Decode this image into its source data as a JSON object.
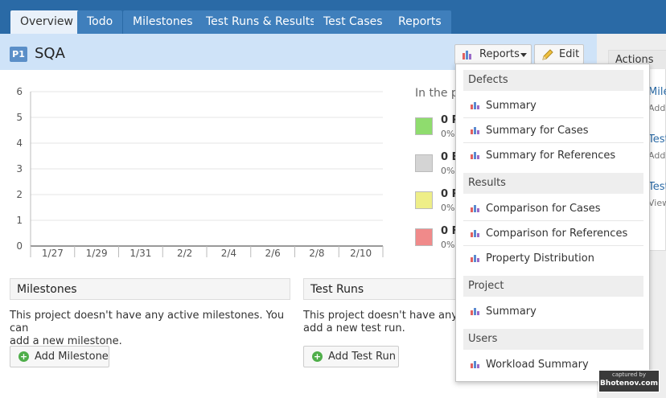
{
  "nav": {
    "tabs": [
      {
        "label": "Overview"
      },
      {
        "label": "Todo"
      },
      {
        "label": "Milestones"
      },
      {
        "label": "Test Runs & Results"
      },
      {
        "label": "Test Cases"
      },
      {
        "label": "Reports"
      }
    ],
    "active_tab": "Overview"
  },
  "project": {
    "badge": "P1",
    "title": "SQA"
  },
  "header_buttons": {
    "reports_label": "Reports",
    "edit_label": "Edit"
  },
  "sidebar": {
    "actions_label": "Actions",
    "links": [
      {
        "label": "Mile",
        "sub": "Add"
      },
      {
        "label": "Test",
        "sub": "Add"
      },
      {
        "label": "Test",
        "sub": "View"
      }
    ]
  },
  "chart_data": {
    "type": "line",
    "categories": [
      "1/27",
      "1/29",
      "1/31",
      "2/2",
      "2/4",
      "2/6",
      "2/8",
      "2/10"
    ],
    "series": [],
    "ylim": [
      0,
      6
    ],
    "yticks": [
      0,
      1,
      2,
      3,
      4,
      5,
      6
    ],
    "grid": true
  },
  "legend": {
    "title": "In the p",
    "entries": [
      {
        "count": "0 P",
        "pct": "0%",
        "color": "#8fdc6e"
      },
      {
        "count": "0 B",
        "pct": "0%",
        "color": "#d4d4d4"
      },
      {
        "count": "0 R",
        "pct": "0%",
        "color": "#eeee88"
      },
      {
        "count": "0 F",
        "pct": "0%",
        "color": "#f08a8a"
      }
    ]
  },
  "milestones": {
    "header": "Milestones",
    "text_line1": "This project doesn't have any active milestones. You can",
    "text_line2": "add a new milestone.",
    "button": "Add Milestone"
  },
  "test_runs": {
    "header": "Test Runs",
    "text_line1": "This project doesn't have any a",
    "text_line2": "add a new test run.",
    "button": "Add Test Run"
  },
  "reports_menu": {
    "groups": [
      {
        "title": "Defects",
        "items": [
          "Summary",
          "Summary for Cases",
          "Summary for References"
        ]
      },
      {
        "title": "Results",
        "items": [
          "Comparison for Cases",
          "Comparison for References",
          "Property Distribution"
        ]
      },
      {
        "title": "Project",
        "items": [
          "Summary"
        ]
      },
      {
        "title": "Users",
        "items": [
          "Workload Summary"
        ]
      }
    ]
  },
  "watermark": {
    "line1": "captured by",
    "line2": "Bhotenov.com"
  },
  "colors": {
    "nav_bg": "#2a6aa6",
    "tab_bg": "#3f7fbc",
    "project_bar": "#cfe3f8",
    "accent_green": "#4fae4a"
  }
}
